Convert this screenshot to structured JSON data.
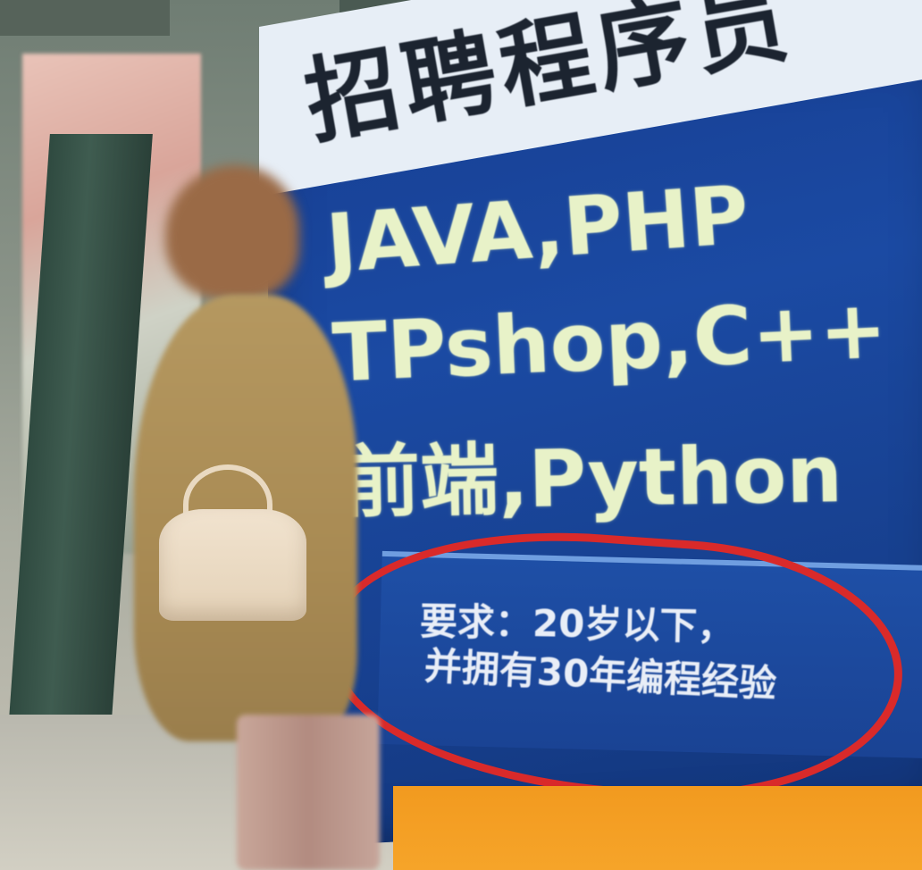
{
  "billboard": {
    "header": "招聘程序员",
    "languages": [
      "JAVA,PHP",
      "TPshop,C++",
      "前端,Python"
    ],
    "requirements": [
      "要求：20岁以下，",
      "并拥有30年编程经验"
    ]
  },
  "colors": {
    "board_blue": "#1b4aa3",
    "text_yellow_green": "#e8f2c8",
    "highlight_red": "#d92a2a",
    "ground_orange": "#f29a1f"
  }
}
